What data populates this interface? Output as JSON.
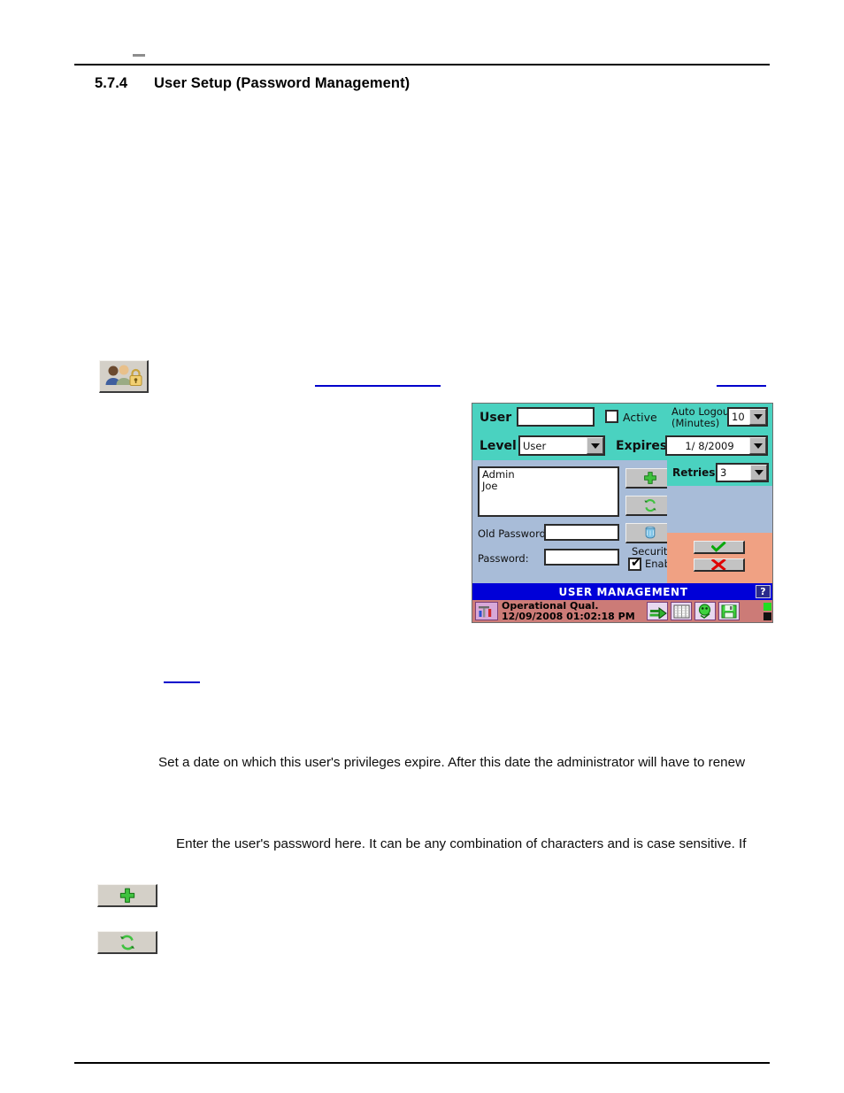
{
  "document": {
    "header_mark": "–",
    "section_number": "5.7.4",
    "section_title": "User Setup (Password Management)",
    "paragraphs": {
      "expires": "Set a date on which this user's privileges expire. After this date the administrator will have to renew",
      "password": "Enter the user's password here. It can be any combination of characters and is case sensitive. If"
    },
    "icons": {
      "users_lock": "users-lock-icon",
      "add": "add-user-icon",
      "update": "update-user-icon"
    }
  },
  "device_screen": {
    "form": {
      "user_label": "User",
      "user_value": "",
      "active_label": "Active",
      "active_checked": false,
      "auto_logout_label_line1": "Auto Logout",
      "auto_logout_label_line2": "(Minutes)",
      "auto_logout_value": "10",
      "level_label": "Level",
      "level_value": "User",
      "expires_label": "Expires",
      "expires_value": "1/  8/2009",
      "retries_label": "Retries",
      "retries_value": "3",
      "old_password_label": "Old Password",
      "old_password_value": "",
      "password_label": "Password:",
      "password_value": "",
      "security_label_line1": "Security",
      "security_label_line2": "Enable",
      "security_checked": true,
      "check_glyph": "✔"
    },
    "user_list": [
      "Admin",
      "Joe"
    ],
    "buttons": {
      "add": "add-icon",
      "update": "refresh-icon",
      "delete": "trash-icon",
      "ok": "check-icon",
      "cancel": "cancel-icon",
      "ok_glyph": "✔",
      "cancel_glyph": "✘"
    },
    "title_bar": {
      "title": "USER MANAGEMENT",
      "help_label": "?"
    },
    "status_bar": {
      "mode": "Operational Qual.",
      "timestamp": "12/09/2008 01:02:18 PM",
      "icons": [
        "tool-icon",
        "trend-icon",
        "grid-icon",
        "alarm-icon",
        "save-icon"
      ]
    }
  },
  "colors": {
    "teal": "#4ad2c0",
    "panel_blue": "#a8bcd8",
    "salmon": "#f0a183",
    "title_blue": "#0000d8",
    "status_red": "#cc7b77",
    "link_blue": "#0000cc"
  }
}
